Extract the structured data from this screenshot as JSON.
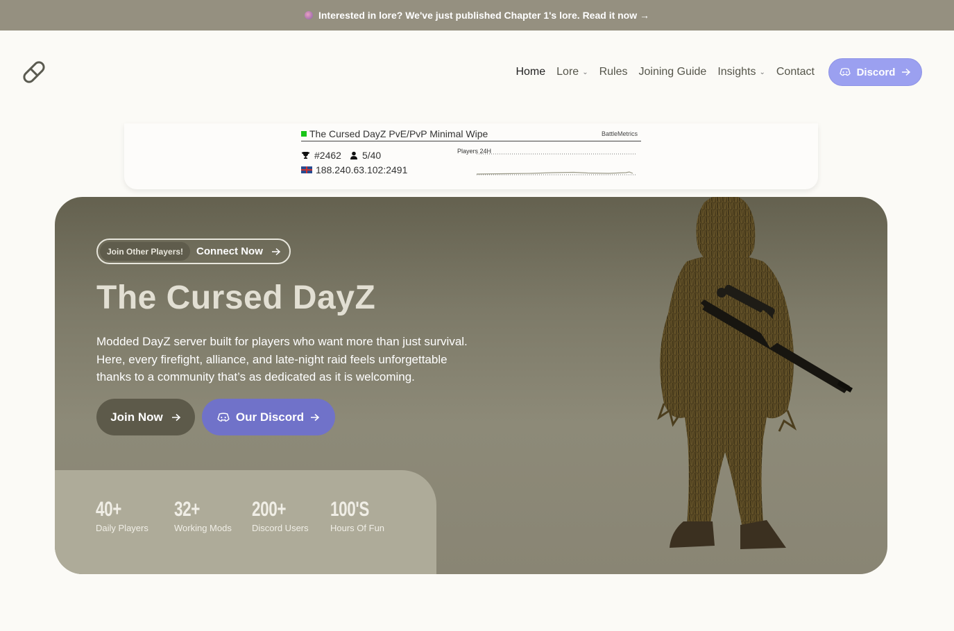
{
  "announcement": {
    "text": "Interested in lore? We've just published Chapter 1's lore. Read it now →"
  },
  "nav": {
    "items": [
      {
        "label": "Home",
        "dropdown": false
      },
      {
        "label": "Lore",
        "dropdown": true
      },
      {
        "label": "Rules",
        "dropdown": false
      },
      {
        "label": "Joining Guide",
        "dropdown": false
      },
      {
        "label": "Insights",
        "dropdown": true
      },
      {
        "label": "Contact",
        "dropdown": false
      }
    ],
    "discord_label": "Discord"
  },
  "battlemetrics": {
    "server_name": "The Cursed DayZ PvE/PvP Minimal Wipe",
    "brand": "BattleMetrics",
    "rank": "#2462",
    "players": "5/40",
    "address": "188.240.63.102:2491",
    "graph_label": "Players 24H"
  },
  "hero": {
    "pill_tag": "Join Other Players!",
    "pill_cta": "Connect Now",
    "title": "The Cursed DayZ",
    "description": "Modded DayZ server built for players who want more than just survival. Here, every firefight, alliance, and late-night raid feels unforgettable thanks to a community that’s as dedicated as it is welcoming.",
    "join_label": "Join Now",
    "discord_label": "Our Discord"
  },
  "stats": [
    {
      "value": "40+",
      "label": "Daily Players"
    },
    {
      "value": "32+",
      "label": "Working Mods"
    },
    {
      "value": "200+",
      "label": "Discord Users"
    },
    {
      "value": "100'S",
      "label": "Hours Of Fun"
    }
  ],
  "colors": {
    "accent": "#7072c9",
    "topbar": "#959080",
    "hero": "#7d7a68",
    "online": "#19c519"
  }
}
